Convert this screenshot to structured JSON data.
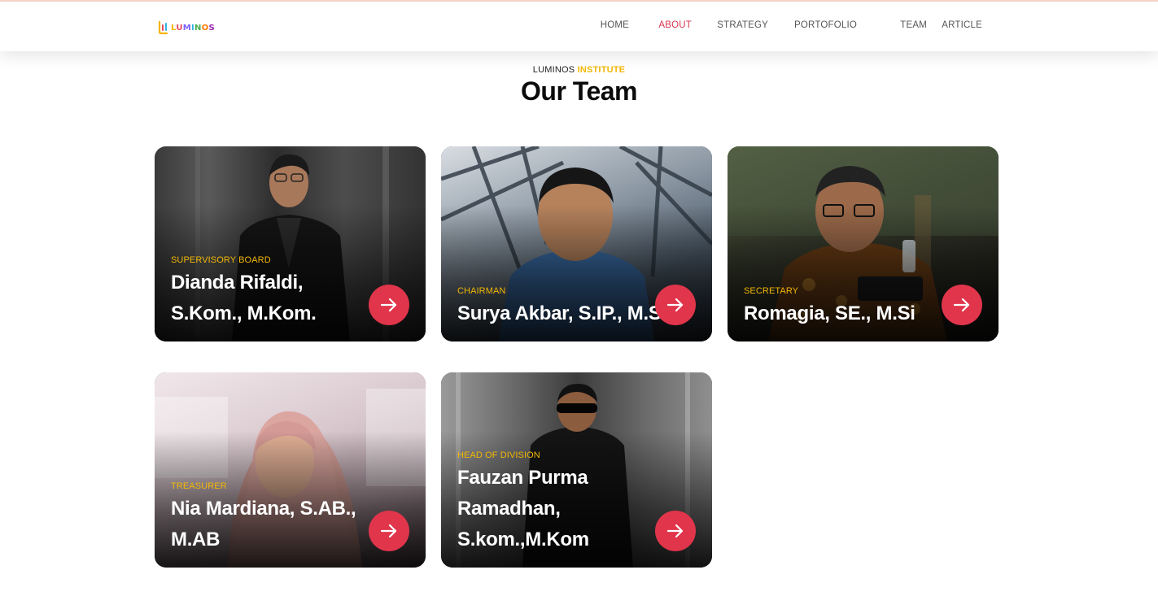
{
  "brand": {
    "name": "LUMINOS",
    "letters": [
      "L",
      "U",
      "M",
      "I",
      "N",
      "O",
      "S"
    ]
  },
  "nav": {
    "items": [
      {
        "label": "HOME",
        "active": false
      },
      {
        "label": "ABOUT",
        "active": true
      },
      {
        "label": "STRATEGY",
        "active": false
      },
      {
        "label": "PORTOFOLIO",
        "active": false
      },
      {
        "label": "TEAM",
        "active": false
      },
      {
        "label": "ARTICLE",
        "active": false
      }
    ]
  },
  "section": {
    "eyebrow_prefix": "LUMINOS",
    "eyebrow_highlight": "INSTITUTE",
    "title": "Our Team"
  },
  "team": [
    {
      "role": "SUPERVISORY BOARD",
      "name": "Dianda Rifaldi, S.Kom., M.Kom."
    },
    {
      "role": "CHAIRMAN",
      "name": "Surya Akbar, S.IP., M.Si"
    },
    {
      "role": "SECRETARY",
      "name": "Romagia, SE., M.Si"
    },
    {
      "role": "TREASURER",
      "name": "Nia Mardiana, S.AB., M.AB"
    },
    {
      "role": "HEAD OF DIVISION",
      "name": "Fauzan Purma Ramadhan, S.kom.,M.Kom"
    }
  ],
  "colors": {
    "accent_red": "#e0354b",
    "accent_yellow": "#f2b705",
    "nav_active": "#d8344a"
  }
}
